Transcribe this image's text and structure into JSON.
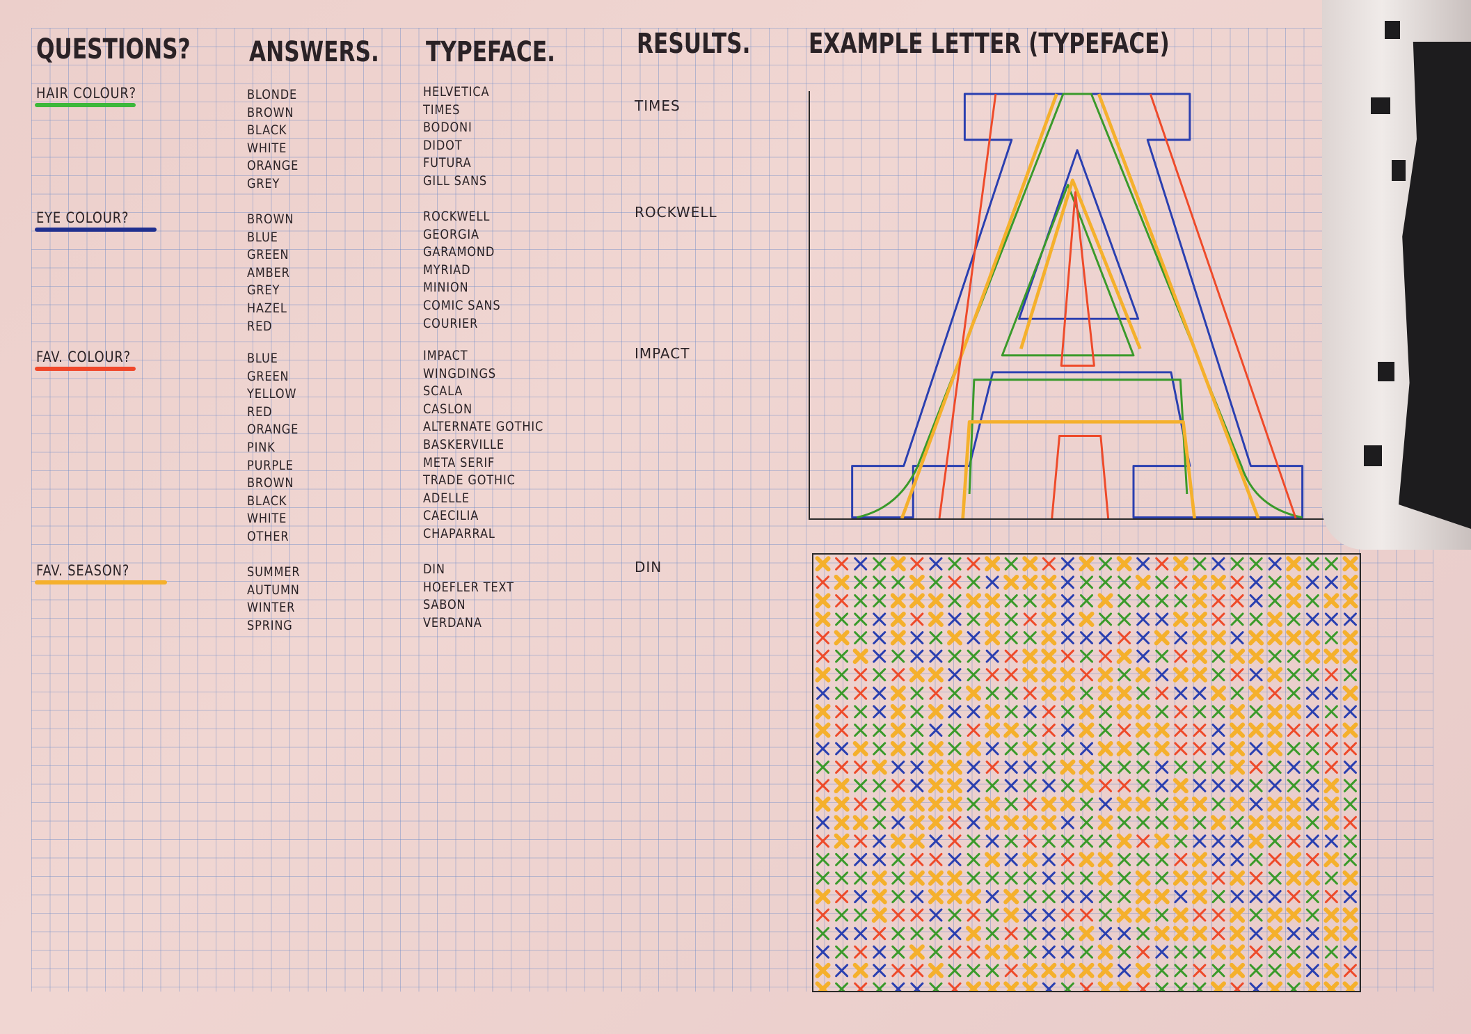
{
  "headers": {
    "questions": "Questions?",
    "answers": "Answers.",
    "typeface": "Typeface.",
    "results": "Results.",
    "example": "Example Letter (Typeface)"
  },
  "sections": [
    {
      "question": "Hair colour?",
      "color": "#3cb83a",
      "answers": [
        "Blonde",
        "Brown",
        "Black",
        "White",
        "Orange",
        "Grey"
      ],
      "typefaces": [
        "Helvetica",
        "Times",
        "Bodoni",
        "Didot",
        "Futura",
        "Gill Sans"
      ],
      "result": "Times"
    },
    {
      "question": "Eye colour?",
      "color": "#1f2f8f",
      "answers": [
        "Brown",
        "Blue",
        "Green",
        "Amber",
        "Grey",
        "Hazel",
        "Red"
      ],
      "typefaces": [
        "Rockwell",
        "Georgia",
        "Garamond",
        "Myriad",
        "Minion",
        "Comic Sans",
        "Courier"
      ],
      "result": "Rockwell"
    },
    {
      "question": "Fav. colour?",
      "color": "#f0472a",
      "answers": [
        "Blue",
        "Green",
        "Yellow",
        "Red",
        "Orange",
        "Pink",
        "Purple",
        "Brown",
        "Black",
        "White",
        "Other"
      ],
      "typefaces": [
        "Impact",
        "Wingdings",
        "Scala",
        "Caslon",
        "Alternate Gothic",
        "Baskerville",
        "Meta Serif",
        "Trade Gothic",
        "Adelle",
        "Caecilia",
        "Chaparral"
      ],
      "result": "Impact"
    },
    {
      "question": "Fav. season?",
      "color": "#f5b02c",
      "answers": [
        "Summer",
        "Autumn",
        "Winter",
        "Spring"
      ],
      "typefaces": [
        "DIN",
        "Hoefler Text",
        "Sabon",
        "Verdana"
      ],
      "result": "DIN"
    }
  ],
  "palette": {
    "blue": "#2a3fb0",
    "green": "#3a9a2a",
    "yellow": "#f5b02c",
    "red": "#ee4a2a"
  }
}
